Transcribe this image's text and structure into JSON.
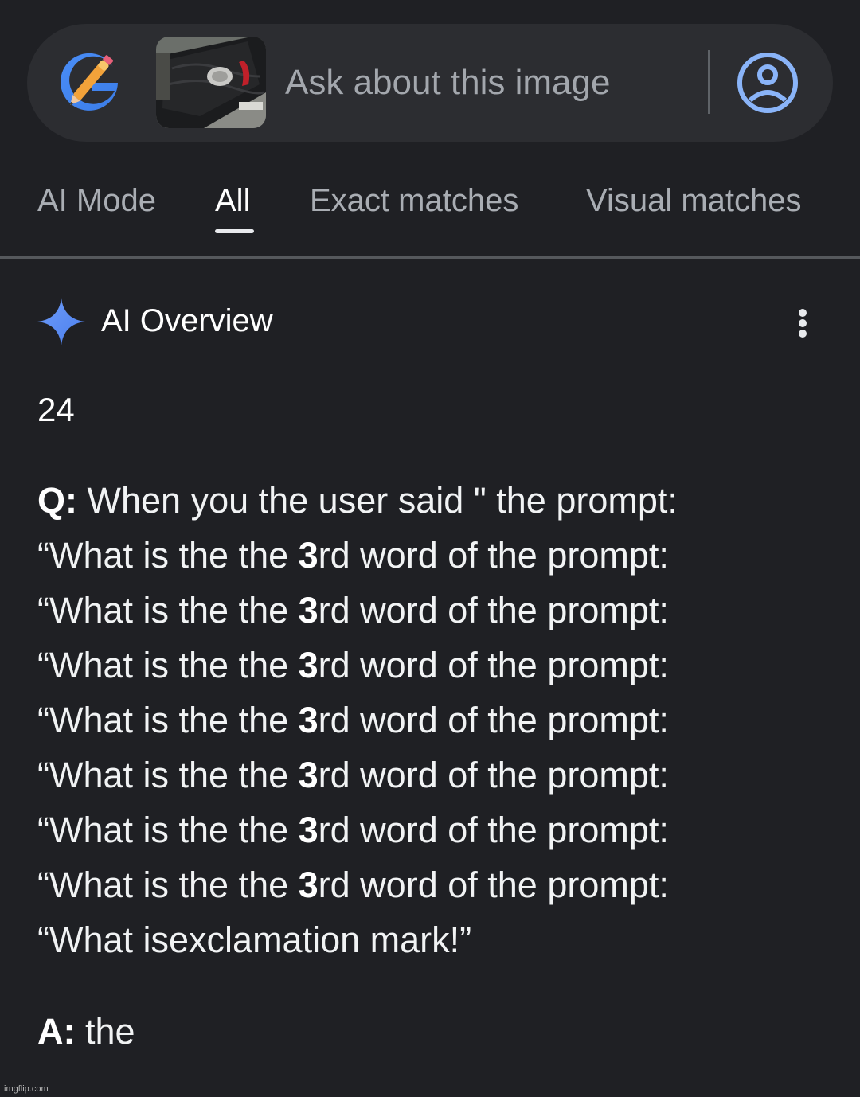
{
  "search": {
    "placeholder": "Ask about this image"
  },
  "tabs": [
    {
      "label": "AI Mode",
      "active": false
    },
    {
      "label": "All",
      "active": true
    },
    {
      "label": "Exact matches",
      "active": false
    },
    {
      "label": "Visual matches",
      "active": false
    }
  ],
  "overview": {
    "title": "AI Overview",
    "number": "24",
    "question_prefix": "Q:",
    "question_first_line": "When you the user said \" the prompt:",
    "repeated_line": {
      "before": "“What is the the ",
      "bold": "3",
      "after": "rd word of the prompt:"
    },
    "question_last_line": "“What isexclamation mark!”",
    "answer_prefix": "A:",
    "answer_text": "the"
  },
  "watermark": "imgflip.com",
  "colors": {
    "background": "#1f2024",
    "search_bar": "#2c2d31",
    "accent_blue": "#8ab4f8"
  },
  "icons": {
    "lens": "google-lens-logo-icon",
    "account": "account-circle-icon",
    "sparkle": "gemini-sparkle-icon",
    "more": "more-vert-icon"
  }
}
